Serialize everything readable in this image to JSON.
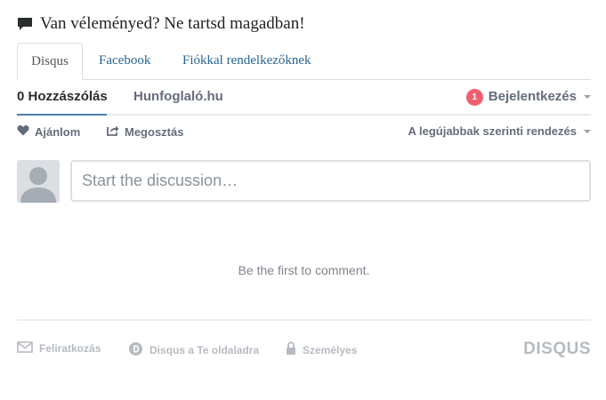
{
  "prompt": {
    "icon": "speech-bubble-icon",
    "text": "Van véleményed? Ne tartsd magadban!"
  },
  "provider_tabs": [
    {
      "label": "Disqus",
      "active": true
    },
    {
      "label": "Facebook",
      "active": false
    },
    {
      "label": "Fiókkal rendelkezőknek",
      "active": false
    }
  ],
  "nav": {
    "comments_label": "0 Hozzászólás",
    "community_label": "Hunfoglaló.hu",
    "login_badge": "1",
    "login_label": "Bejelentkezés"
  },
  "toolbar": {
    "recommend_label": "Ajánlom",
    "share_label": "Megosztás",
    "sort_label": "A legújabbak szerinti rendezés"
  },
  "composer": {
    "placeholder": "Start the discussion…"
  },
  "empty_state": "Be the first to comment.",
  "footer": {
    "subscribe_label": "Feliratkozás",
    "add_site_label": "Disqus a Te oldaladra",
    "privacy_label": "Személyes",
    "brand": "DISQUS"
  },
  "colors": {
    "link": "#2a6496",
    "badge": "#f05f70",
    "active_underline": "#4a7fad",
    "muted": "#b6bbc1"
  }
}
